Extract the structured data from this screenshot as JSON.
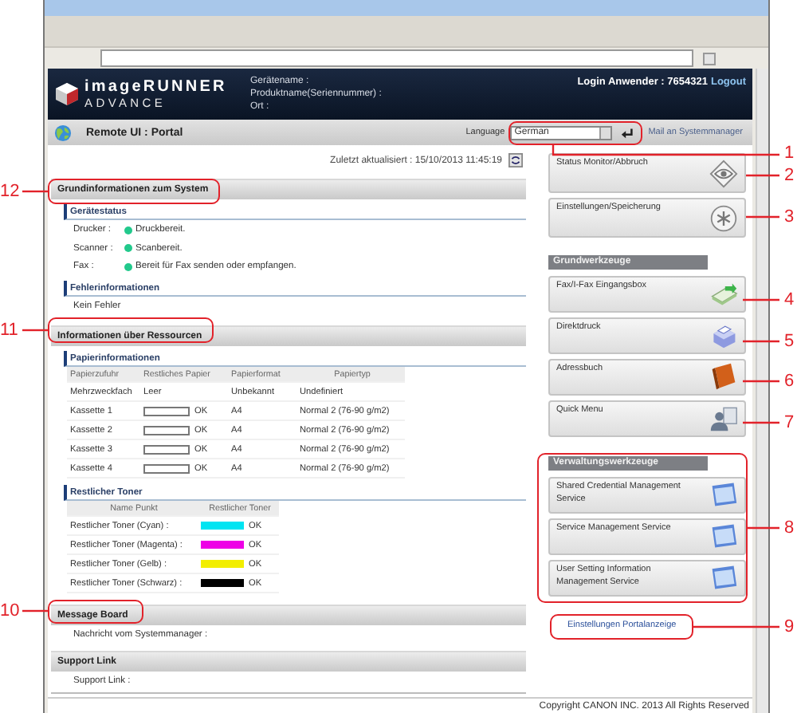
{
  "header": {
    "logo_top": "imageRUNNER",
    "logo_bottom": "ADVANCE",
    "device_labels": [
      "Gerätename :",
      "Produktname(Seriennummer) :",
      "Ort :"
    ],
    "login": "Login Anwender : 7654321",
    "logout": "Logout"
  },
  "toolbar": {
    "title": "Remote UI : Portal",
    "language_label": "Language",
    "language_value": "German",
    "mail_link": "Mail an Systemmanager"
  },
  "last_updated": "Zuletzt aktualisiert : 15/10/2013 11:45:19",
  "system": {
    "title": "Grundinformationen zum System",
    "status_title": "Gerätestatus",
    "status": [
      {
        "label": "Drucker :",
        "text": "Druckbereit.",
        "color": "#22c98c"
      },
      {
        "label": "Scanner :",
        "text": "Scanbereit.",
        "color": "#22c98c"
      },
      {
        "label": "Fax :",
        "text": "Bereit für Fax senden oder empfangen.",
        "color": "#22c98c"
      }
    ],
    "error_title": "Fehlerinformationen",
    "error_text": "Kein Fehler"
  },
  "resources": {
    "title": "Informationen über Ressourcen",
    "paper_title": "Papierinformationen",
    "paper_columns": [
      "Papierzufuhr",
      "Restliches Papier",
      "Papierformat",
      "Papiertyp"
    ],
    "paper_rows": [
      {
        "source": "Mehrzweckfach",
        "kind": "text",
        "remaining": "Leer",
        "format": "Unbekannt",
        "type": "Undefiniert"
      },
      {
        "source": "Kassette 1",
        "kind": "bar",
        "remaining": "OK",
        "format": "A4",
        "type": "Normal 2 (76-90 g/m2)"
      },
      {
        "source": "Kassette 2",
        "kind": "bar",
        "remaining": "OK",
        "format": "A4",
        "type": "Normal 2 (76-90 g/m2)"
      },
      {
        "source": "Kassette 3",
        "kind": "bar",
        "remaining": "OK",
        "format": "A4",
        "type": "Normal 2 (76-90 g/m2)"
      },
      {
        "source": "Kassette 4",
        "kind": "bar",
        "remaining": "OK",
        "format": "A4",
        "type": "Normal 2 (76-90 g/m2)"
      }
    ],
    "toner_title": "Restlicher Toner",
    "toner_columns": [
      "Name Punkt",
      "Restlicher Toner"
    ],
    "toner_rows": [
      {
        "name": "Restlicher Toner (Cyan) :",
        "color": "#00e4f2",
        "status": "OK"
      },
      {
        "name": "Restlicher Toner (Magenta) :",
        "color": "#ee00e6",
        "status": "OK"
      },
      {
        "name": "Restlicher Toner (Gelb) :",
        "color": "#f2ee00",
        "status": "OK"
      },
      {
        "name": "Restlicher Toner (Schwarz) :",
        "color": "#000000",
        "status": "OK"
      }
    ]
  },
  "message_board": {
    "title": "Message Board",
    "text": "Nachricht vom Systemmanager :"
  },
  "support": {
    "title": "Support Link",
    "text": "Support Link :"
  },
  "top_buttons": [
    {
      "label": "Status Monitor/Abbruch"
    },
    {
      "label": "Einstellungen/Speicherung"
    }
  ],
  "basic_tools": {
    "title": "Grundwerkzeuge",
    "buttons": [
      {
        "label": "Fax/I-Fax Eingangsbox"
      },
      {
        "label": "Direktdruck"
      },
      {
        "label": "Adressbuch"
      },
      {
        "label": "Quick Menu"
      }
    ]
  },
  "admin_tools": {
    "title": "Verwaltungswerkzeuge",
    "buttons": [
      {
        "label": "Shared Credential Management Service"
      },
      {
        "label": "Service Management Service"
      },
      {
        "label": "User Setting Information Management Service"
      }
    ]
  },
  "portal_link": "Einstellungen Portalanzeige",
  "copyright": "Copyright CANON INC. 2013 All Rights Reserved",
  "callouts": [
    {
      "number": "1"
    },
    {
      "number": "2"
    },
    {
      "number": "3"
    },
    {
      "number": "4"
    },
    {
      "number": "5"
    },
    {
      "number": "6"
    },
    {
      "number": "7"
    },
    {
      "number": "8"
    },
    {
      "number": "9"
    },
    {
      "number": "12"
    },
    {
      "number": "11"
    },
    {
      "number": "10"
    }
  ]
}
